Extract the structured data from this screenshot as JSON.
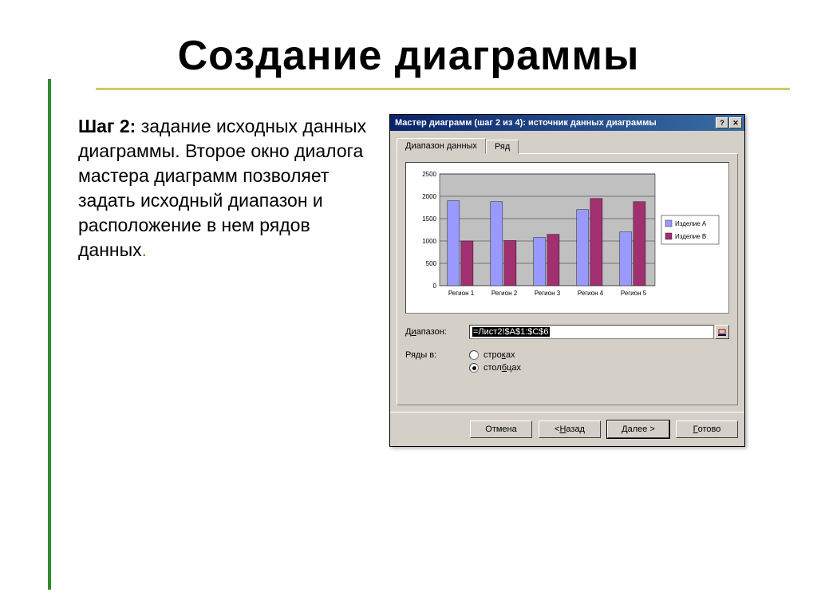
{
  "slide": {
    "title": "Создание диаграммы",
    "step_label": "Шаг 2:",
    "body_text": " задание исходных данных диаграммы. Второе окно диалога мастера диаграмм позволяет задать исходный диапазон и расположение в нем рядов данных"
  },
  "dialog": {
    "title": "Мастер диаграмм (шаг 2 из 4): источник данных диаграммы",
    "help_btn": "?",
    "close_btn": "✕",
    "tabs": {
      "active": "Диапазон данных",
      "inactive": "Ряд"
    },
    "range": {
      "label_pre": "Д",
      "label_u": "и",
      "label_post": "апазон:",
      "value": "=Лист2!$A$1:$C$6"
    },
    "rows_in": {
      "label": "Ряды в:",
      "opt_rows_pre": "стро",
      "opt_rows_u": "к",
      "opt_rows_post": "ах",
      "opt_cols_pre": "стол",
      "opt_cols_u": "б",
      "opt_cols_post": "цах",
      "selected": "cols"
    },
    "buttons": {
      "cancel": "Отмена",
      "back_pre": "< ",
      "back_u": "Н",
      "back_post": "азад",
      "next_pre": "",
      "next_u": "Д",
      "next_post": "алее >",
      "finish_pre": "",
      "finish_u": "Г",
      "finish_post": "отово"
    }
  },
  "chart_data": {
    "type": "bar",
    "categories": [
      "Регион 1",
      "Регион 2",
      "Регион 3",
      "Регион 4",
      "Регион 5"
    ],
    "series": [
      {
        "name": "Изделие A",
        "values": [
          1900,
          1880,
          1080,
          1700,
          1200
        ],
        "color": "#9999ff"
      },
      {
        "name": "Изделие B",
        "values": [
          1000,
          1010,
          1150,
          1950,
          1880
        ],
        "color": "#a03070"
      }
    ],
    "ylim": [
      0,
      2500
    ],
    "yticks": [
      0,
      500,
      1000,
      1500,
      2000,
      2500
    ],
    "legend": [
      "Изделие A",
      "Изделие B"
    ]
  }
}
